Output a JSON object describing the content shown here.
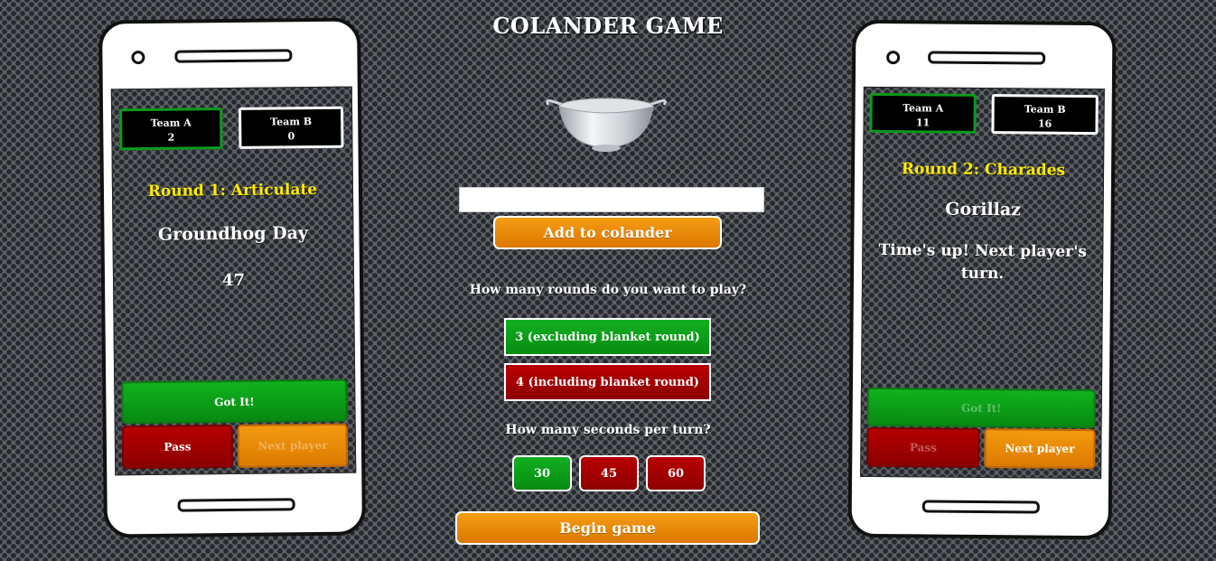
{
  "app": {
    "title": "COLANDER GAME"
  },
  "left_phone": {
    "team_a": {
      "name": "Team A",
      "score": "2",
      "active": true
    },
    "team_b": {
      "name": "Team B",
      "score": "0",
      "active": false
    },
    "round": "Round 1: Articulate",
    "word": "Groundhog Day",
    "timer": "47",
    "buttons": {
      "got_it": "Got It!",
      "pass": "Pass",
      "next_player": "Next player"
    }
  },
  "right_phone": {
    "team_a": {
      "name": "Team A",
      "score": "11",
      "active": true
    },
    "team_b": {
      "name": "Team B",
      "score": "16",
      "active": false
    },
    "round": "Round 2: Charades",
    "word": "Gorillaz",
    "message": "Time's up! Next player's turn.",
    "buttons": {
      "got_it": "Got It!",
      "pass": "Pass",
      "next_player": "Next player"
    }
  },
  "setup": {
    "input_value": "",
    "add_button": "Add to colander",
    "rounds_question": "How many rounds do you want to play?",
    "rounds_options": [
      "3 (excluding blanket round)",
      "4 (including blanket round)"
    ],
    "seconds_question": "How many seconds per turn?",
    "seconds_options": [
      "30",
      "45",
      "60"
    ],
    "begin_button": "Begin game"
  },
  "colors": {
    "green": "#0c9a1a",
    "red": "#a00000",
    "orange": "#f0900c",
    "yellow": "#ffeb00",
    "background": "#5d6166"
  }
}
